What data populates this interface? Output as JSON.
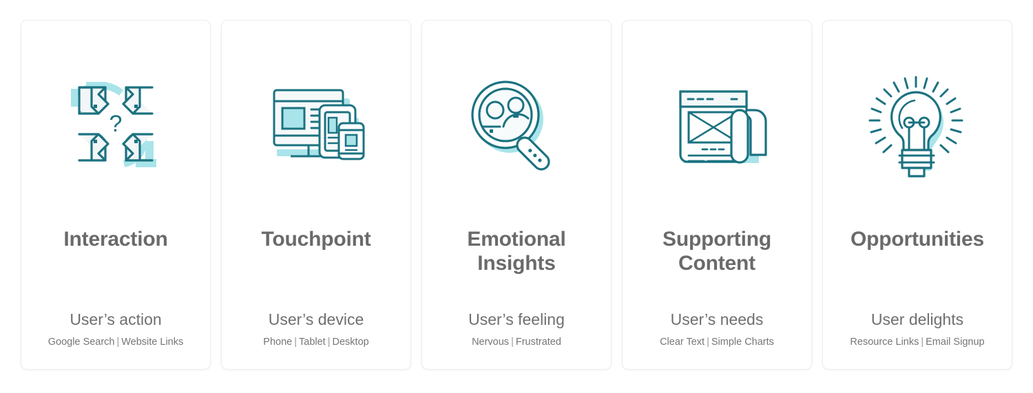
{
  "theme": {
    "stroke_dark": "#1b7280",
    "accent_cyan": "#a9e4ea",
    "fill_light": "#f2f6f8",
    "title_gray": "#6a6a6a",
    "sub_gray": "#6f6f6f",
    "example_gray": "#757575",
    "card_bg": "#ffffff",
    "page_bg": "#ffffff",
    "card_border": "#eeeeee"
  },
  "cards": [
    {
      "icon_name": "four-arrows-question-icon",
      "title": "Interaction",
      "subtitle": "User’s action",
      "examples": [
        "Google Search",
        "Website Links"
      ],
      "separator": "|"
    },
    {
      "icon_name": "devices-responsive-icon",
      "title": "Touchpoint",
      "subtitle": "User’s device",
      "examples": [
        "Phone",
        "Tablet",
        "Desktop"
      ],
      "separator": "|"
    },
    {
      "icon_name": "magnifier-users-icon",
      "title": "Emotional Insights",
      "title_line1": "Emotional",
      "title_line2": "Insights",
      "subtitle": "User’s feeling",
      "examples": [
        "Nervous",
        "Frustrated"
      ],
      "separator": "|"
    },
    {
      "icon_name": "document-scroll-icon",
      "title": "Supporting Content",
      "title_line1": "Supporting",
      "title_line2": "Content",
      "subtitle": "User’s needs",
      "examples": [
        "Clear Text",
        "Simple Charts"
      ],
      "separator": "|"
    },
    {
      "icon_name": "lightbulb-idea-icon",
      "title": "Opportunities",
      "subtitle": "User delights",
      "examples": [
        "Resource Links",
        "Email Signup"
      ],
      "separator": "|"
    }
  ]
}
